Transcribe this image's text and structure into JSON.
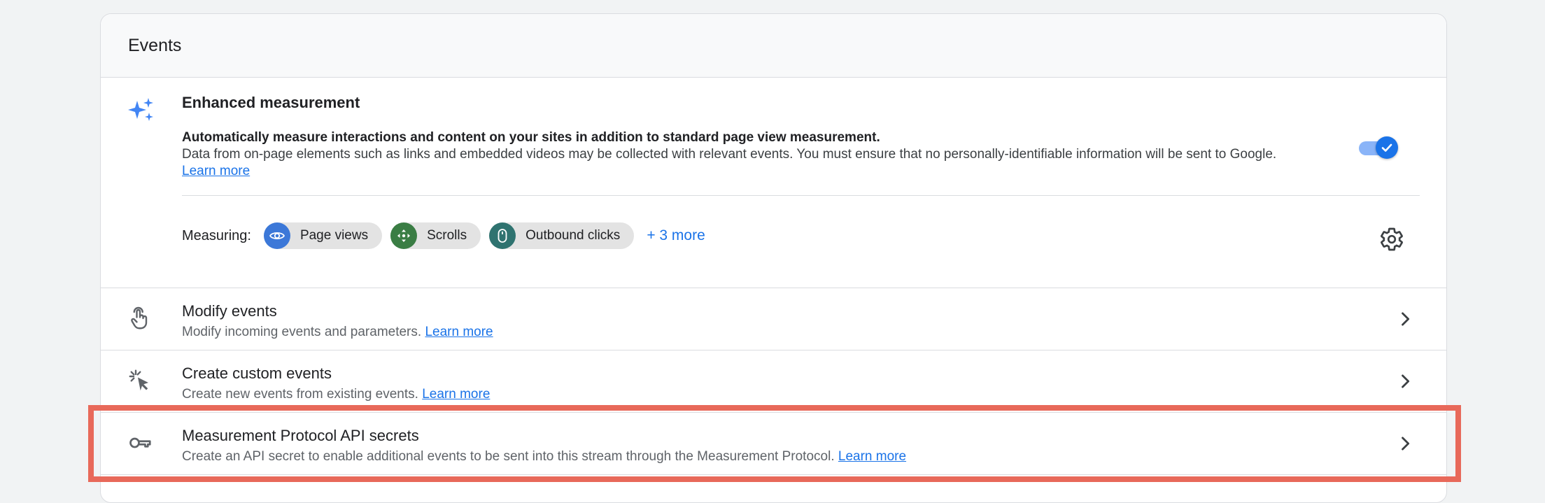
{
  "card": {
    "title": "Events"
  },
  "enhanced_measurement": {
    "title": "Enhanced measurement",
    "desc_bold": "Automatically measure interactions and content on your sites in addition to standard page view measurement.",
    "desc": "Data from on-page elements such as links and embedded videos may be collected with relevant events. You must ensure that no personally-identifiable information will be sent to Google.",
    "learn_more": "Learn more",
    "toggle_on": true,
    "measuring_label": "Measuring:",
    "chips": [
      {
        "label": "Page views",
        "icon": "eye-icon",
        "color": "#3c78d8"
      },
      {
        "label": "Scrolls",
        "icon": "scroll-arrows-icon",
        "color": "#3a7d44"
      },
      {
        "label": "Outbound clicks",
        "icon": "mouse-icon",
        "color": "#2f7370"
      }
    ],
    "more": "+ 3 more",
    "settings_icon": "gear-icon"
  },
  "rows": [
    {
      "title": "Modify events",
      "sub": "Modify incoming events and parameters.",
      "learn_more": "Learn more",
      "icon": "touch-hand-icon"
    },
    {
      "title": "Create custom events",
      "sub": "Create new events from existing events.",
      "learn_more": "Learn more",
      "icon": "click-sparkle-icon"
    },
    {
      "title": "Measurement Protocol API secrets",
      "sub": "Create an API secret to enable additional events to be sent into this stream through the Measurement Protocol.",
      "learn_more": "Learn more",
      "icon": "key-icon"
    }
  ],
  "colors": {
    "accent": "#1a73e8",
    "highlight": "#e8695a"
  }
}
